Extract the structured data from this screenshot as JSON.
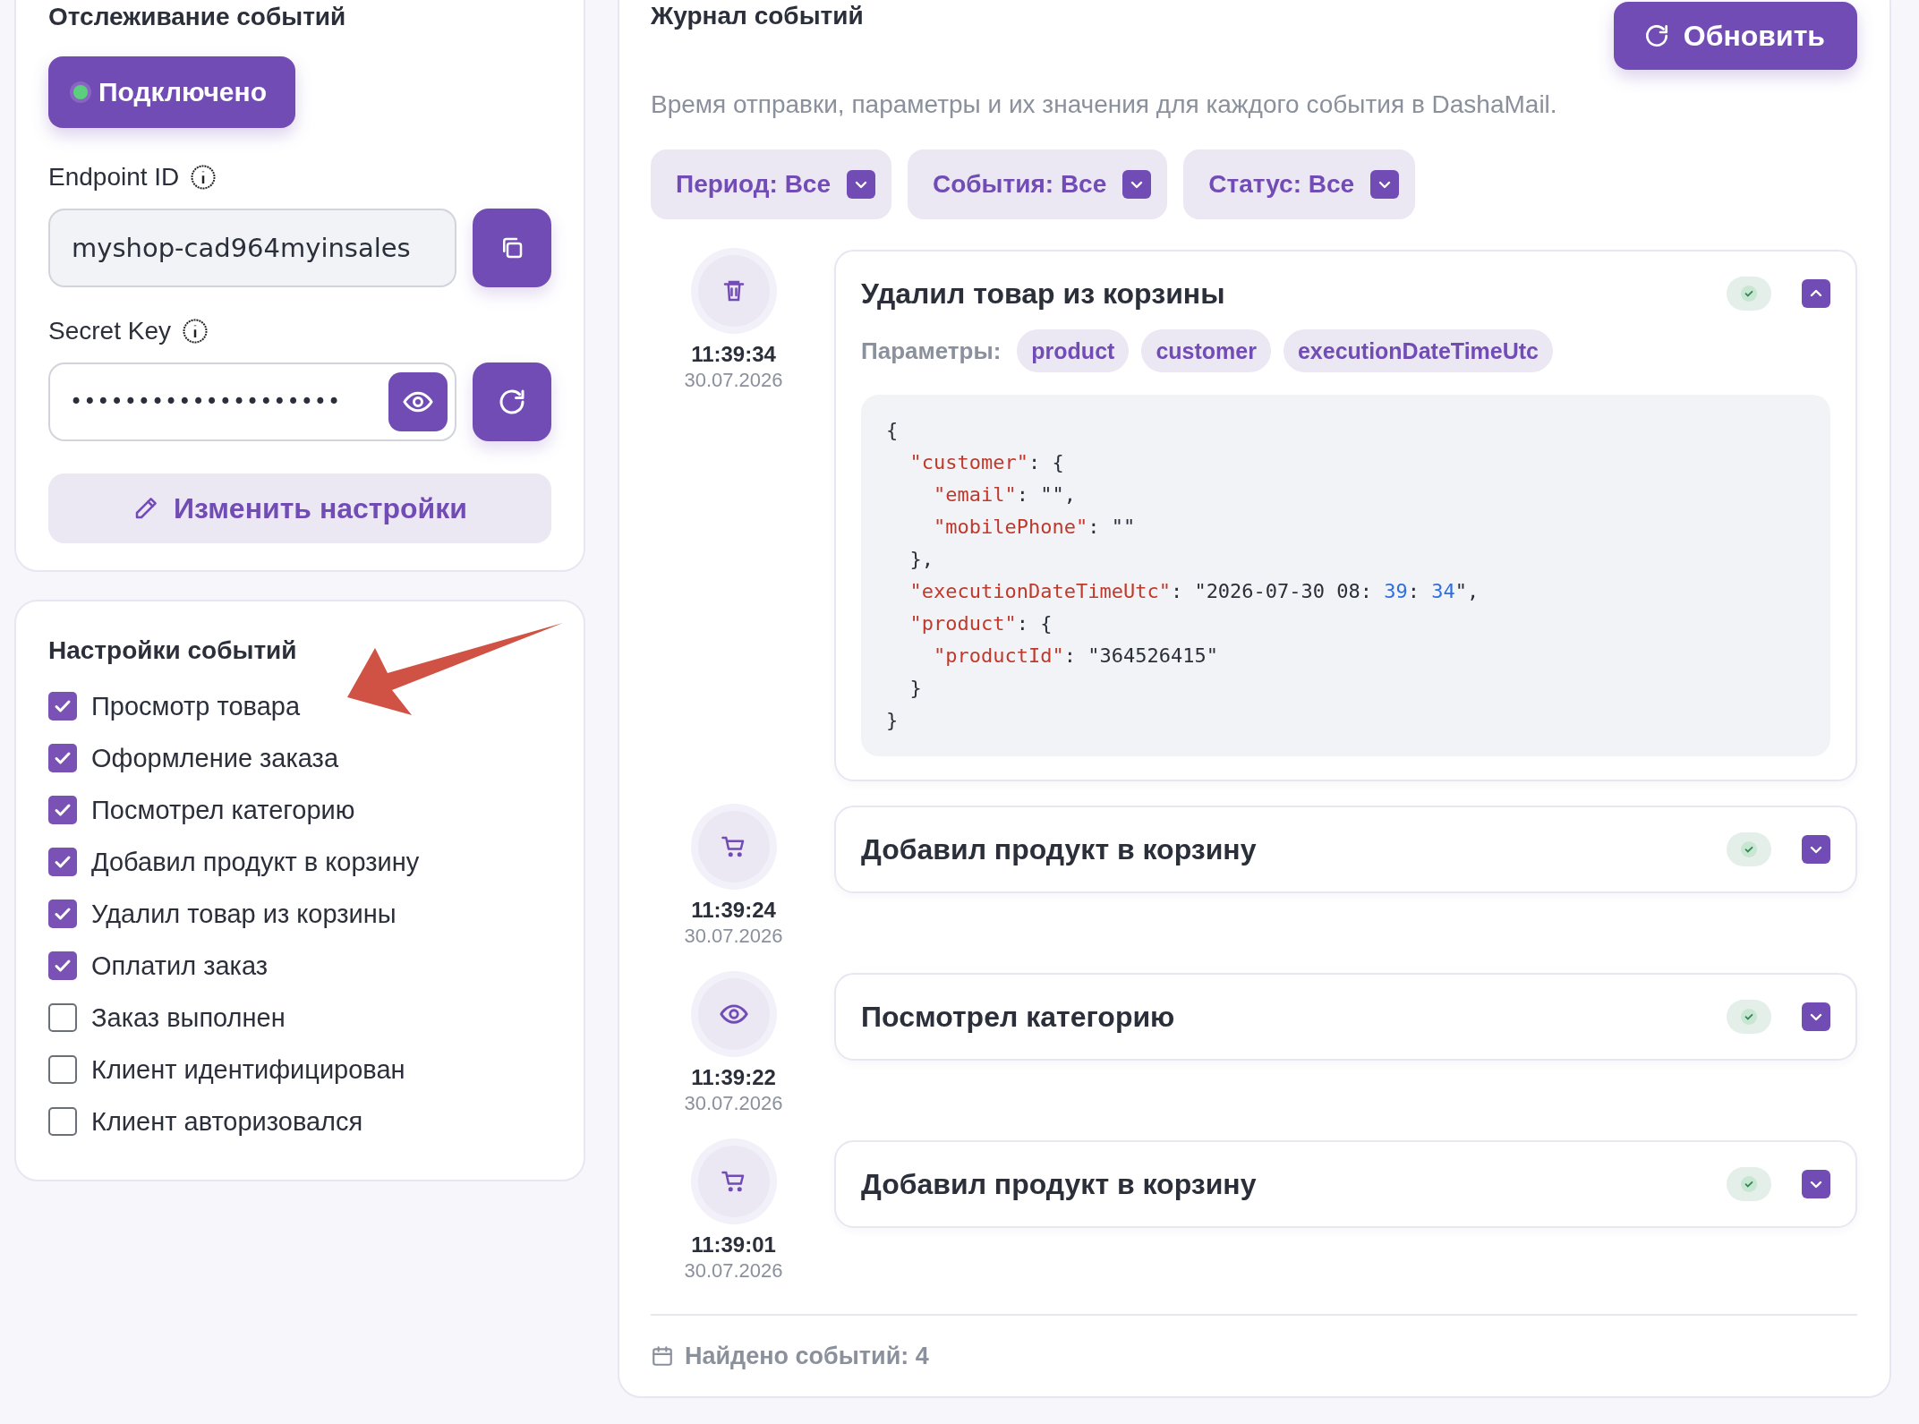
{
  "tracking": {
    "title": "Отслеживание событий",
    "connection": {
      "label": "Подключено",
      "connected": true
    },
    "endpoint": {
      "label": "Endpoint ID",
      "value": "myshop-cad964myinsales"
    },
    "secret": {
      "label": "Secret Key",
      "value": "••••••••••••••••••••"
    },
    "edit_button": "Изменить настройки"
  },
  "event_settings": {
    "title": "Настройки событий",
    "items": [
      {
        "label": "Просмотр товара",
        "checked": true
      },
      {
        "label": "Оформление заказа",
        "checked": true
      },
      {
        "label": "Посмотрел категорию",
        "checked": true
      },
      {
        "label": "Добавил продукт в корзину",
        "checked": true
      },
      {
        "label": "Удалил товар из корзины",
        "checked": true
      },
      {
        "label": "Оплатил заказ",
        "checked": true
      },
      {
        "label": "Заказ выполнен",
        "checked": false
      },
      {
        "label": "Клиент идентифицирован",
        "checked": false
      },
      {
        "label": "Клиент авторизовался",
        "checked": false
      }
    ]
  },
  "log": {
    "title": "Журнал событий",
    "refresh_button": "Обновить",
    "description": "Время отправки, параметры и их значения для каждого события в DashaMail.",
    "filters": [
      "Период: Все",
      "События: Все",
      "Статус: Все"
    ],
    "events": [
      {
        "kind": "trash",
        "time": "11:39:34",
        "date": "30.07.2026",
        "title": "Удалил товар из корзины",
        "expanded": true,
        "params_label": "Параметры:",
        "params": [
          "product",
          "customer",
          "executionDateTimeUtc"
        ],
        "payload": [
          [
            {
              "text": "{",
              "kind": "plain"
            }
          ],
          [
            {
              "text": "  \"customer\"",
              "kind": "key"
            },
            {
              "text": ": {",
              "kind": "plain"
            }
          ],
          [
            {
              "text": "    \"email\"",
              "kind": "key"
            },
            {
              "text": ": \"\",",
              "kind": "plain"
            }
          ],
          [
            {
              "text": "    \"mobilePhone\"",
              "kind": "key"
            },
            {
              "text": ": \"\"",
              "kind": "plain"
            }
          ],
          [
            {
              "text": "  },",
              "kind": "plain"
            }
          ],
          [
            {
              "text": "  \"executionDateTimeUtc\"",
              "kind": "key"
            },
            {
              "text": ": \"2026-07-30 08: ",
              "kind": "plain"
            },
            {
              "text": "39",
              "kind": "number"
            },
            {
              "text": ": ",
              "kind": "plain"
            },
            {
              "text": "34",
              "kind": "number"
            },
            {
              "text": "\",",
              "kind": "plain"
            }
          ],
          [
            {
              "text": "  \"product\"",
              "kind": "key"
            },
            {
              "text": ": {",
              "kind": "plain"
            }
          ],
          [
            {
              "text": "    \"productId\"",
              "kind": "key"
            },
            {
              "text": ": \"364526415\"",
              "kind": "plain"
            }
          ],
          [
            {
              "text": "  }",
              "kind": "plain"
            }
          ],
          [
            {
              "text": "}",
              "kind": "plain"
            }
          ]
        ]
      },
      {
        "kind": "cart",
        "time": "11:39:24",
        "date": "30.07.2026",
        "title": "Добавил продукт в корзину",
        "expanded": false
      },
      {
        "kind": "eye",
        "time": "11:39:22",
        "date": "30.07.2026",
        "title": "Посмотрел категорию",
        "expanded": false
      },
      {
        "kind": "cart",
        "time": "11:39:01",
        "date": "30.07.2026",
        "title": "Добавил продукт в корзину",
        "expanded": false
      }
    ],
    "footer": "Найдено событий: 4"
  }
}
